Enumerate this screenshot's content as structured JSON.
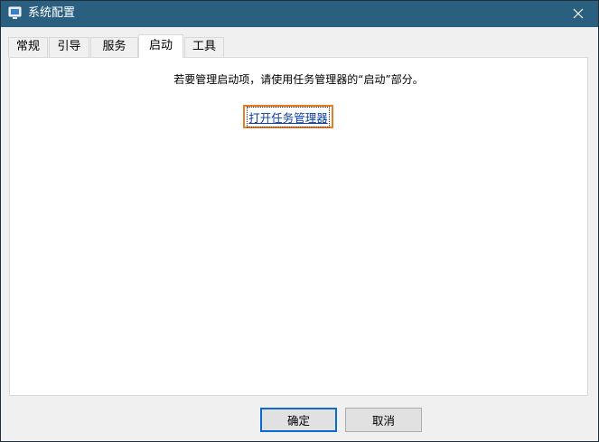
{
  "window": {
    "title": "系统配置"
  },
  "tabs": [
    {
      "label": "常规"
    },
    {
      "label": "引导"
    },
    {
      "label": "服务"
    },
    {
      "label": "启动"
    },
    {
      "label": "工具"
    }
  ],
  "active_tab": "启动",
  "startup": {
    "instruction": "若要管理启动项，请使用任务管理器的“启动”部分。",
    "link_label": "打开任务管理器"
  },
  "buttons": {
    "ok_label": "确定",
    "cancel_label": "取消"
  },
  "colors": {
    "titlebar": "#2b5f80",
    "highlight_border": "#e87e22",
    "link": "#0b3ea8",
    "default_button_border": "#0b6bd1"
  },
  "icons": {
    "app": "system-config-icon",
    "close": "close-icon"
  }
}
